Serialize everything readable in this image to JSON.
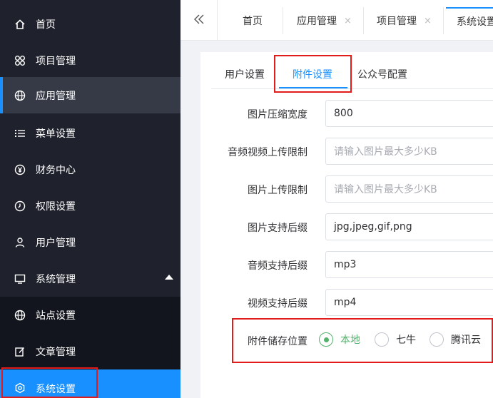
{
  "sidebar": {
    "items": [
      {
        "label": "首页",
        "icon": "home-icon"
      },
      {
        "label": "项目管理",
        "icon": "apps-icon"
      },
      {
        "label": "应用管理",
        "icon": "globe-icon"
      },
      {
        "label": "菜单设置",
        "icon": "list-icon"
      },
      {
        "label": "财务中心",
        "icon": "yen-icon"
      },
      {
        "label": "权限设置",
        "icon": "clock-icon"
      },
      {
        "label": "用户管理",
        "icon": "user-icon"
      },
      {
        "label": "系统管理",
        "icon": "monitor-icon"
      },
      {
        "label": "站点设置",
        "icon": "globe-icon"
      },
      {
        "label": "文章管理",
        "icon": "edit-icon"
      },
      {
        "label": "系统设置",
        "icon": "gear-icon"
      }
    ]
  },
  "tabs": [
    {
      "label": "首页"
    },
    {
      "label": "应用管理",
      "close": "×"
    },
    {
      "label": "项目管理",
      "close": "×"
    },
    {
      "label": "系统设置"
    }
  ],
  "collapse_label": "«",
  "sub_tabs": [
    {
      "label": "用户设置"
    },
    {
      "label": "附件设置"
    },
    {
      "label": "公众号配置"
    }
  ],
  "form": {
    "image_compress_width": {
      "label": "图片压缩宽度",
      "value": "800"
    },
    "av_upload_limit": {
      "label": "音频视频上传限制",
      "placeholder": "请输入图片最大多少KB"
    },
    "image_upload_limit": {
      "label": "图片上传限制",
      "placeholder": "请输入图片最大多少KB"
    },
    "image_suffix": {
      "label": "图片支持后缀",
      "value": "jpg,jpeg,gif,png"
    },
    "audio_suffix": {
      "label": "音频支持后缀",
      "value": "mp3"
    },
    "video_suffix": {
      "label": "视频支持后缀",
      "value": "mp4"
    },
    "storage": {
      "label": "附件储存位置",
      "options": [
        "本地",
        "七牛",
        "腾讯云"
      ],
      "selected": "本地"
    }
  },
  "colors": {
    "accent": "#1890ff",
    "sidebar_bg": "#1f222d",
    "radio_checked": "#52b26b",
    "highlight_box": "#e21b1b"
  }
}
